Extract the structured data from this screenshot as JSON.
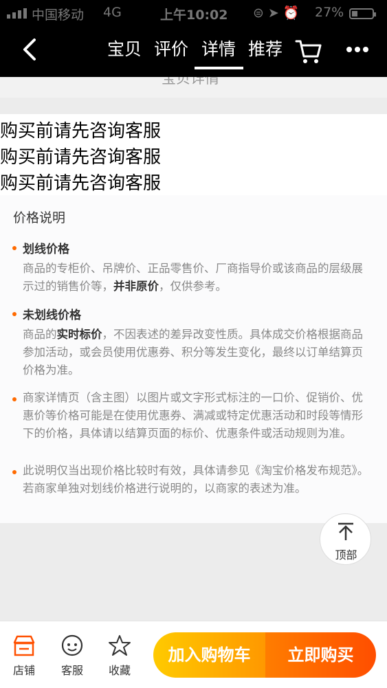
{
  "status_bar": {
    "carrier": "中国移动",
    "network": "4G",
    "time": "上午10:02",
    "battery": "27%",
    "battery_level": 0.27,
    "icons": [
      "lock-rotation-icon",
      "location-arrow-icon",
      "alarm-icon"
    ]
  },
  "header": {
    "tabs": [
      "宝贝",
      "评价",
      "详情",
      "推荐"
    ],
    "active_tab": "详情"
  },
  "section_peek_title": "宝贝详情",
  "notices": [
    "购买前请先咨询客服",
    "购买前请先咨询客服",
    "购买前请先咨询客服"
  ],
  "price_info": {
    "title": "价格说明",
    "items": [
      {
        "title": "划线价格",
        "text_1": "商品的专柜价、吊牌价、正品零售价、厂商指导价或该商品的层级展示过的销售价等，",
        "bold": "并非原价",
        "text_2": "，仅供参考。"
      },
      {
        "title": "未划线价格",
        "text_1": "商品的",
        "bold": "实时标价",
        "text_2": "，不因表述的差异改变性质。具体成交价格根据商品参加活动，或会员使用优惠券、积分等发生变化，最终以订单结算页价格为准。"
      },
      {
        "text": "商家详情页（含主图）以图片或文字形式标注的一口价、促销价、优惠价等价格可能是在使用优惠券、满减或特定优惠活动和时段等情形下的价格，具体请以结算页面的标价、优惠条件或活动规则为准。"
      },
      {
        "text": "此说明仅当出现价格比较时有效，具体请参见《淘宝价格发布规范》。若商家单独对划线价格进行说明的，以商家的表述为准。"
      }
    ]
  },
  "to_top_label": "顶部",
  "bottom_bar": {
    "shop": "店铺",
    "service": "客服",
    "favorite": "收藏",
    "add_to_cart": "加入购物车",
    "buy_now": "立即购买"
  },
  "colors": {
    "accent_orange": "#ff6a00",
    "cart_gradient": [
      "#ffca00",
      "#ff9800"
    ],
    "buy_gradient": [
      "#ff7d00",
      "#ff4e00"
    ]
  }
}
